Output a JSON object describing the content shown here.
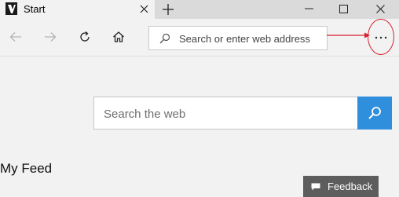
{
  "tab": {
    "title": "Start"
  },
  "window_controls": {
    "minimize_icon": "minimize-icon",
    "maximize_icon": "maximize-icon",
    "close_icon": "close-icon"
  },
  "nav": {
    "back_icon": "arrow-left-icon",
    "forward_icon": "arrow-right-icon",
    "refresh_icon": "refresh-icon",
    "home_icon": "home-icon",
    "address_placeholder": "Search or enter web address",
    "more_label": "···"
  },
  "main": {
    "search_placeholder": "Search the web",
    "feed_title": "My Feed",
    "feedback_label": "Feedback"
  },
  "colors": {
    "accent": "#2f8fdc",
    "annotation": "#d9202e",
    "feedback_bg": "#5d5d5d"
  }
}
